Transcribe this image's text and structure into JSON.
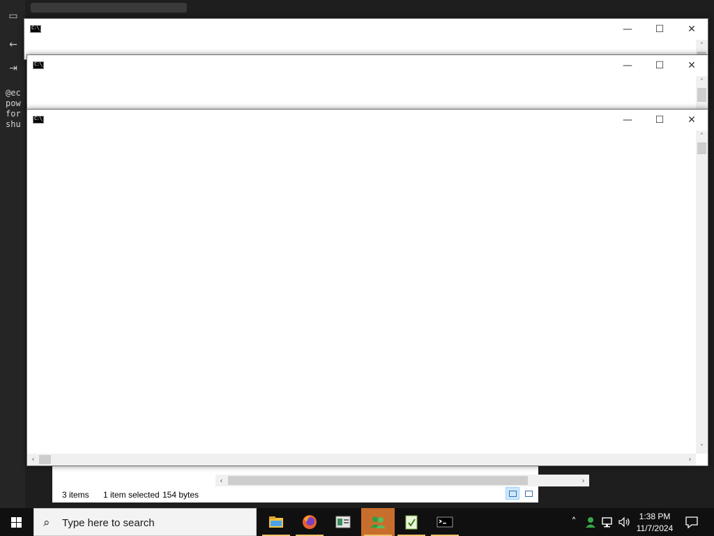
{
  "background_editor": {
    "code_lines": [
      "@ec",
      "pow",
      "for",
      "shu"
    ]
  },
  "explorer": {
    "item_count": "3 items",
    "selection": "1 item selected",
    "size": "154 bytes"
  },
  "cmd_windows": [
    {
      "id": "cmd-window-back",
      "icon": "cmd-icon"
    },
    {
      "id": "cmd-window-middle",
      "icon": "cmd-icon"
    },
    {
      "id": "cmd-window-front",
      "icon": "cmd-icon"
    }
  ],
  "window_controls": {
    "minimize": "—",
    "maximize": "☐",
    "close": "✕"
  },
  "taskbar": {
    "search_placeholder": "Type here to search",
    "apps": [
      {
        "name": "file-explorer-icon",
        "active": false
      },
      {
        "name": "firefox-icon",
        "active": false
      },
      {
        "name": "app-window-icon",
        "active": false
      },
      {
        "name": "users-icon",
        "active": true
      },
      {
        "name": "notepad-icon",
        "active": false
      },
      {
        "name": "cmd-icon",
        "active": false
      }
    ],
    "clock_time": "1:38 PM",
    "clock_date": "11/7/2024"
  },
  "colors": {
    "taskbar": "#101010",
    "active_app": "#c86e2c",
    "editor_bg": "#1e1e1e"
  }
}
